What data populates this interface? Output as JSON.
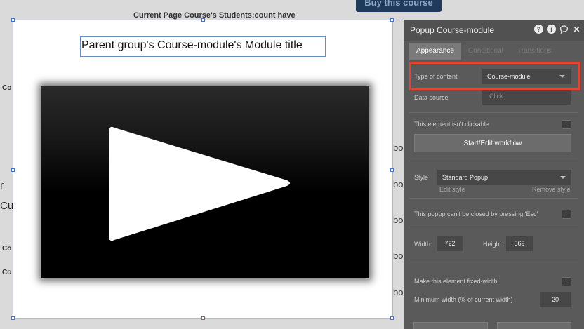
{
  "background": {
    "top_label": "Current Page Course's Students:count have",
    "buy_button": "Buy this course",
    "left_labels": [
      "Co",
      "Co",
      "Co"
    ],
    "big_letters": [
      "r",
      "Cu"
    ],
    "right_fragments": [
      "boo",
      "boo",
      "boo",
      "boo",
      "boo"
    ]
  },
  "popup": {
    "title": "Parent group's Course-module's Module title",
    "video_icon": "play-icon"
  },
  "editor": {
    "title": "Popup Course-module",
    "icons": [
      "help-icon",
      "info-icon",
      "comment-icon",
      "close-icon"
    ],
    "help_glyph": "?",
    "info_glyph": "i",
    "close_glyph": "✕",
    "tabs": [
      {
        "label": "Appearance",
        "active": true
      },
      {
        "label": "Conditional",
        "active": false
      },
      {
        "label": "Transitions",
        "active": false
      }
    ],
    "type_of_content_label": "Type of content",
    "type_of_content_value": "Course-module",
    "data_source_label": "Data source",
    "data_source_placeholder": "Click",
    "not_clickable_label": "This element isn't clickable",
    "workflow_button": "Start/Edit workflow",
    "style_label": "Style",
    "style_value": "Standard Popup",
    "edit_style_link": "Edit style",
    "remove_style_link": "Remove style",
    "esc_label": "This popup can't be closed by pressing 'Esc'",
    "width_label": "Width",
    "width_value": "722",
    "height_label": "Height",
    "height_value": "569",
    "fixed_width_label": "Make this element fixed-width",
    "min_width_label": "Minimum width (% of current width)",
    "min_width_value": "20"
  },
  "colors": {
    "highlight": "#e0453a",
    "editor_bg": "#5a5a5a",
    "handle": "#4a73c7"
  }
}
